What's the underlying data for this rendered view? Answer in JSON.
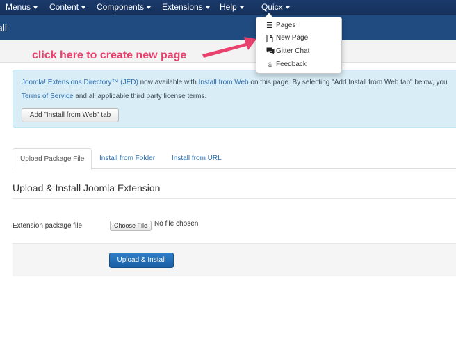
{
  "topnav": {
    "menus": [
      "Menus",
      "Content",
      "Components",
      "Extensions",
      "Help"
    ],
    "quicx": "Quicx"
  },
  "subheader": {
    "title": "all"
  },
  "annotation": "click here to create new page",
  "info": {
    "jed_link": "Joomla! Extensions Directory™ (JED)",
    "text_a": "now available with",
    "install_link": "Install from Web",
    "text_b": "on this page.  By selecting \"Add Install from Web tab\" below, you",
    "tos_link": "Terms of Service",
    "text_c": "and all applicable third party license terms.",
    "add_button": "Add \"Install from Web\" tab"
  },
  "tabs": [
    "Upload Package File",
    "Install from Folder",
    "Install from URL"
  ],
  "section_title": "Upload & Install Joomla Extension",
  "field": {
    "label": "Extension package file",
    "choose_button": "Choose File",
    "status": "No file chosen"
  },
  "submit_button": "Upload & Install",
  "dropdown": {
    "items": [
      {
        "icon": "list-icon",
        "label": "Pages"
      },
      {
        "icon": "new-page-icon",
        "label": "New Page"
      },
      {
        "icon": "chat-icon",
        "label": "Gitter Chat"
      },
      {
        "icon": "smile-icon",
        "label": "Feedback"
      }
    ]
  },
  "colors": {
    "nav": "#1b3a6b",
    "subheader": "#1f4b80",
    "annotation": "#e8416e",
    "info_bg": "#d9edf7",
    "primary": "#2d7fc9",
    "link": "#2a6eb0"
  }
}
